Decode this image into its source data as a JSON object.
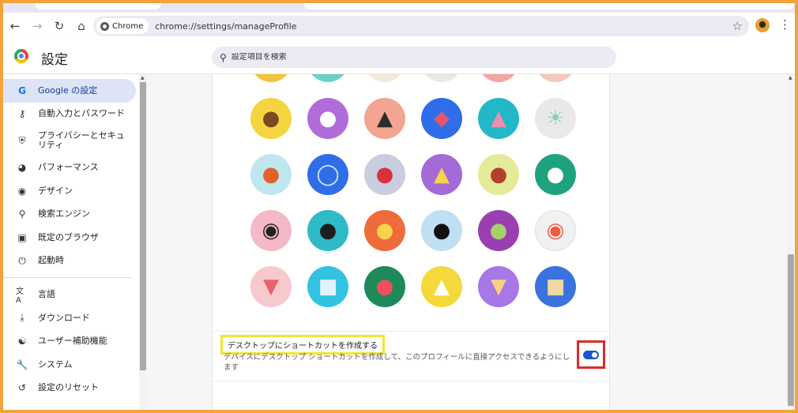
{
  "browser": {
    "site_chip": "Chrome",
    "url": "chrome://settings/manageProfile"
  },
  "settings": {
    "title": "設定",
    "search_placeholder": "設定項目を検索"
  },
  "sidebar": {
    "items": [
      {
        "label": "Google の設定",
        "icon": "google-g-icon",
        "active": true
      },
      {
        "label": "自動入力とパスワード",
        "icon": "key-icon"
      },
      {
        "label": "プライバシーとセキュリティ",
        "icon": "shield-icon"
      },
      {
        "label": "パフォーマンス",
        "icon": "speedometer-icon"
      },
      {
        "label": "デザイン",
        "icon": "palette-icon"
      },
      {
        "label": "検索エンジン",
        "icon": "search-icon"
      },
      {
        "label": "既定のブラウザ",
        "icon": "browser-window-icon"
      },
      {
        "label": "起動時",
        "icon": "power-icon"
      },
      {
        "label": "言語",
        "icon": "translate-icon"
      },
      {
        "label": "ダウンロード",
        "icon": "download-icon"
      },
      {
        "label": "ユーザー補助機能",
        "icon": "accessibility-icon"
      },
      {
        "label": "システム",
        "icon": "wrench-icon"
      },
      {
        "label": "設定のリセット",
        "icon": "reset-icon"
      }
    ]
  },
  "avatars": [
    [
      "monkey-avatar",
      "panda-avatar",
      "penguin-avatar",
      "origami-bird-avatar",
      "rabbit-avatar",
      "unicorn-avatar"
    ],
    [
      "basketball-avatar",
      "bicycle-avatar",
      "red-bird-avatar",
      "cheese-avatar",
      "football-avatar",
      "sushi-plate-avatar"
    ],
    [
      "sunglasses-avatar",
      "sushi-avatar",
      "tamagotchi-avatar",
      "vinyl-record-avatar",
      "avocado-avatar",
      "smile-avatar"
    ],
    [
      "ice-cream-avatar",
      "cube-avatar",
      "watermelon-avatar",
      "onigiri-avatar",
      "pizza-avatar",
      "sandwich-avatar"
    ]
  ],
  "shortcut": {
    "title": "デスクトップにショートカットを作成する",
    "description": "デバイスにデスクトップ ショートカットを作成して、このプロフィールに直接アクセスできるようにします",
    "enabled": true
  }
}
